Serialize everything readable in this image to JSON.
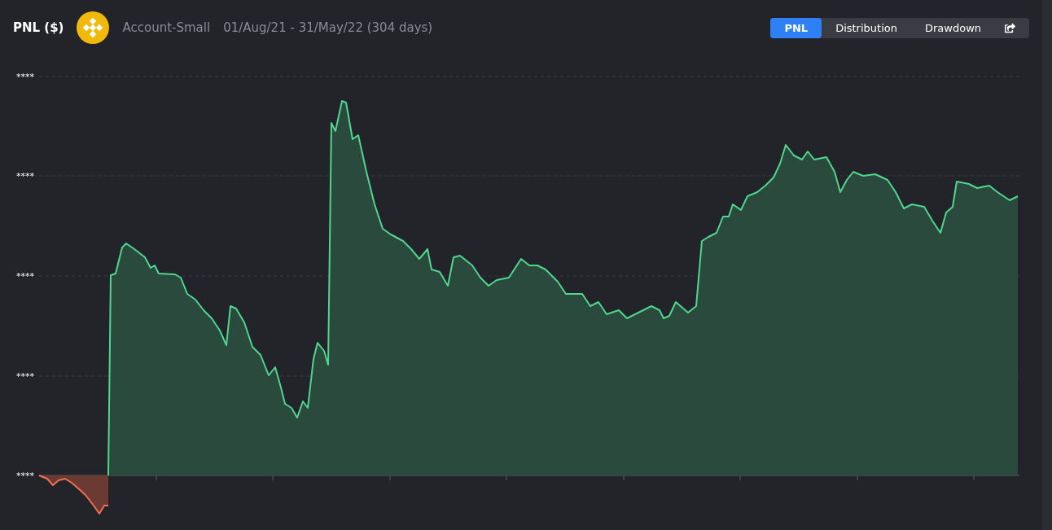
{
  "header": {
    "title": "PNL ($)",
    "account": "Account-Small",
    "date_range": "01/Aug/21 - 31/May/22 (304 days)"
  },
  "view_tabs": [
    {
      "label": "PNL",
      "selected": true
    },
    {
      "label": "Distribution",
      "selected": false
    },
    {
      "label": "Drawdown",
      "selected": false
    }
  ],
  "chart": {
    "y_labels": [
      "****",
      "****",
      "****",
      "****",
      "****"
    ]
  }
}
